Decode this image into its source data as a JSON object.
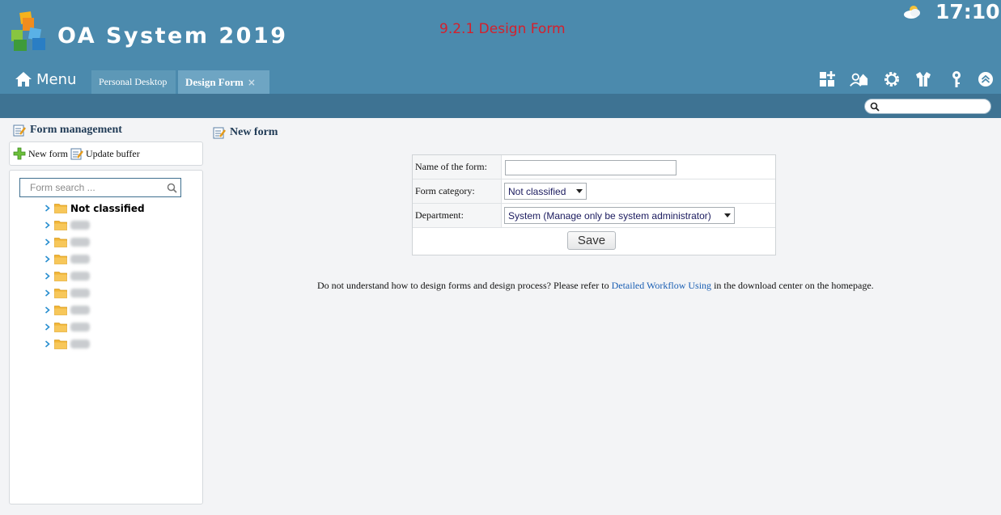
{
  "header": {
    "app_title": "OA System 2019",
    "page_caption": "9.2.1 Design Form",
    "clock": "17:10",
    "menu_label": "Menu",
    "colors": {
      "header_bg": "#4b8aad",
      "subbar_bg": "#3e7393",
      "caption": "#d4202c"
    }
  },
  "tabs": [
    {
      "label": "Personal Desktop",
      "active": false
    },
    {
      "label": "Design Form",
      "active": true,
      "close": "×"
    }
  ],
  "toolbar_icons": [
    "add-app-icon",
    "user-home-icon",
    "settings-icon",
    "shirt-icon",
    "key-icon",
    "collapse-up-icon"
  ],
  "top_search": {
    "placeholder": ""
  },
  "left_panel": {
    "title": "Form management",
    "toolbar": {
      "new_form": "New form",
      "update_buffer": "Update buffer"
    },
    "search": {
      "placeholder": "Form search ..."
    },
    "tree": [
      {
        "label": "Not classified",
        "bold": true,
        "blurred": false
      },
      {
        "label": "",
        "blurred": true
      },
      {
        "label": "",
        "blurred": true
      },
      {
        "label": "",
        "blurred": true
      },
      {
        "label": "",
        "blurred": true
      },
      {
        "label": "",
        "blurred": true
      },
      {
        "label": "",
        "blurred": true
      },
      {
        "label": "",
        "blurred": true
      },
      {
        "label": "",
        "blurred": true
      }
    ]
  },
  "main": {
    "title": "New form",
    "form": {
      "name_label": "Name of the form:",
      "name_value": "",
      "category_label": "Form category:",
      "category_value": "Not classified",
      "department_label": "Department:",
      "department_value": "System (Manage only be system administrator)",
      "save_label": "Save"
    },
    "help": {
      "before": "Do not understand how to design forms and design process? Please refer to ",
      "link": "Detailed Workflow Using",
      "after": " in the download center on the homepage."
    }
  }
}
